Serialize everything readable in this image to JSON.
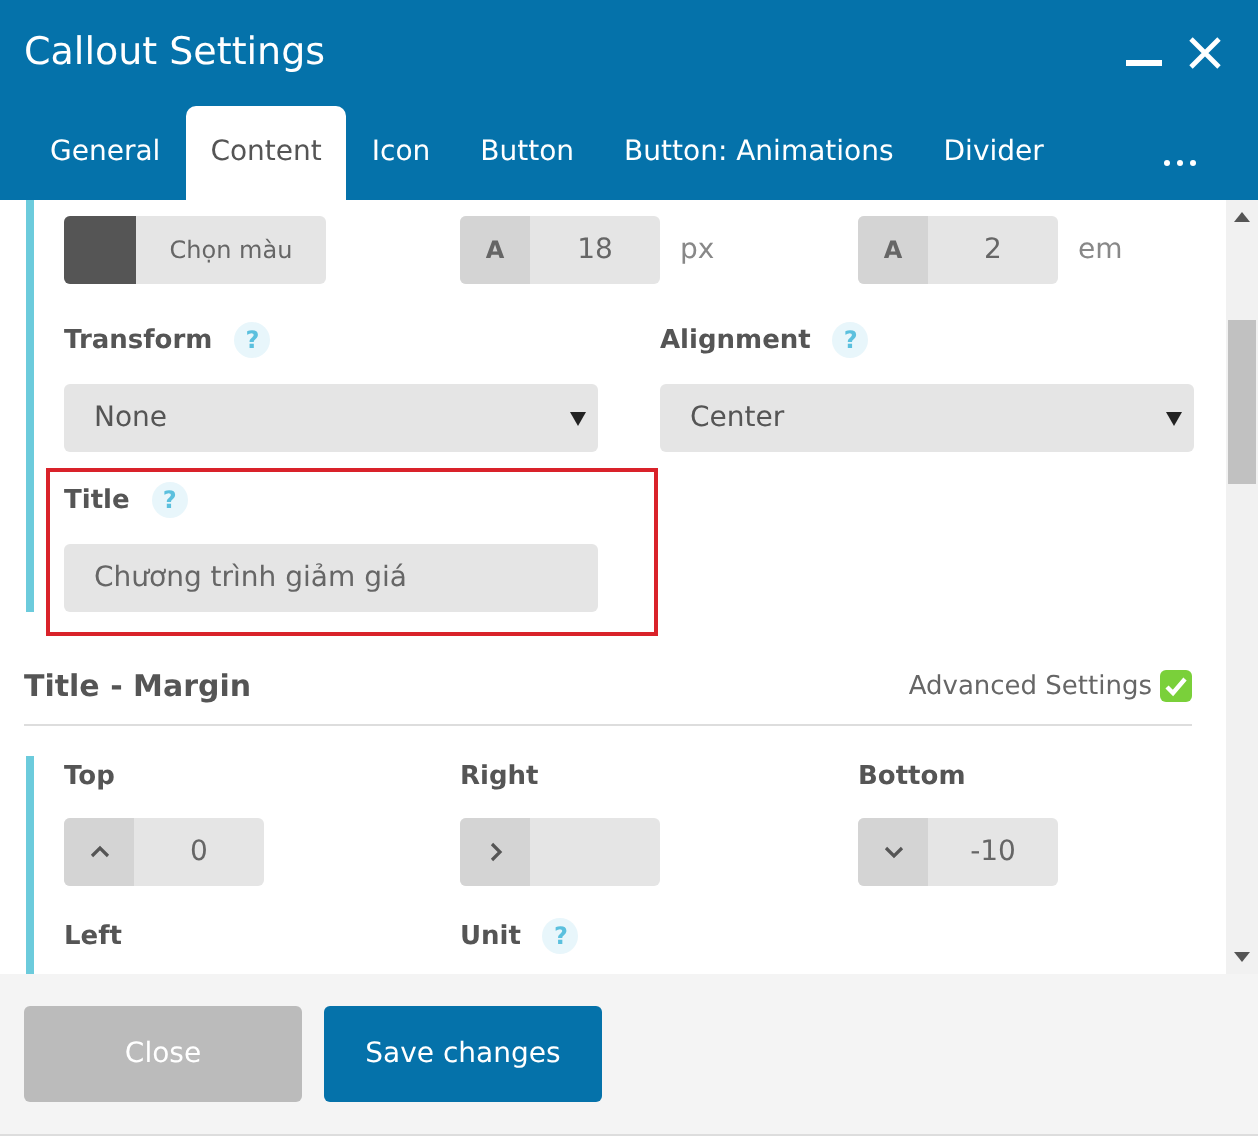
{
  "window": {
    "title": "Callout Settings"
  },
  "tabs": [
    {
      "label": "General",
      "selected": false
    },
    {
      "label": "Content",
      "selected": true
    },
    {
      "label": "Icon",
      "selected": false
    },
    {
      "label": "Button",
      "selected": false
    },
    {
      "label": "Button: Animations",
      "selected": false
    },
    {
      "label": "Divider",
      "selected": false
    }
  ],
  "typography": {
    "color_picker": {
      "label": "Chọn màu"
    },
    "font_size": {
      "prefix": "A",
      "value": "18",
      "unit": "px"
    },
    "line_height": {
      "prefix": "A",
      "value": "2",
      "unit": "em"
    }
  },
  "fields": [
    {
      "label": "Transform",
      "help": "?",
      "kind": "select",
      "value": "None",
      "highlighted": false
    },
    {
      "label": "Alignment",
      "help": "?",
      "kind": "select",
      "value": "Center",
      "highlighted": false
    },
    {
      "label": "Title",
      "help": "?",
      "kind": "text",
      "value": "Chương trình giảm giá",
      "highlighted": true
    }
  ],
  "margin_section": {
    "title": "Title - Margin",
    "advanced_settings": {
      "label": "Advanced Settings",
      "checked": true
    },
    "fields": [
      {
        "label": "Top",
        "kind": "up",
        "value": "0"
      },
      {
        "label": "Right",
        "kind": "right"
      },
      {
        "label": "Bottom",
        "kind": "down",
        "value": "-10"
      },
      {
        "label": "Left"
      },
      {
        "label": "Unit",
        "help": "?"
      }
    ]
  },
  "footer": {
    "buttons": [
      {
        "label": "Close",
        "kind": "secondary"
      },
      {
        "label": "Save changes",
        "kind": "primary"
      }
    ]
  }
}
